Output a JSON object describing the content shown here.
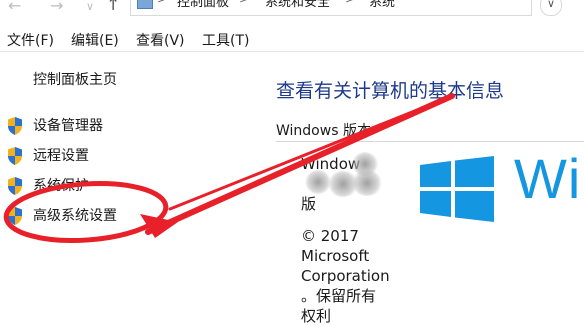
{
  "address_bar": {
    "crumbs": [
      "控制面板",
      "系统和安全",
      "系统"
    ],
    "separator": ">"
  },
  "menu": {
    "items": [
      "文件(F)",
      "编辑(E)",
      "查看(V)",
      "工具(T)"
    ]
  },
  "sidebar": {
    "home_label": "控制面板主页",
    "items": [
      {
        "label": "设备管理器",
        "icon": "uac-shield-icon"
      },
      {
        "label": "远程设置",
        "icon": "uac-shield-icon"
      },
      {
        "label": "系统保护",
        "icon": "uac-shield-icon"
      },
      {
        "label": "高级系统设置",
        "icon": "uac-shield-icon"
      }
    ]
  },
  "main": {
    "title": "查看有关计算机的基本信息",
    "edition_section": "Windows 版本",
    "edition_lines": [
      "Window",
      "",
      "版"
    ],
    "copyright_lines": [
      "© 2017",
      "Microsoft",
      "Corporation",
      "。保留所有",
      "权利"
    ],
    "logo_text": "Wi"
  },
  "colors": {
    "title": "#1e3a8a",
    "windows_blue": "#1596e0",
    "annotation_red": "#e8202a"
  }
}
